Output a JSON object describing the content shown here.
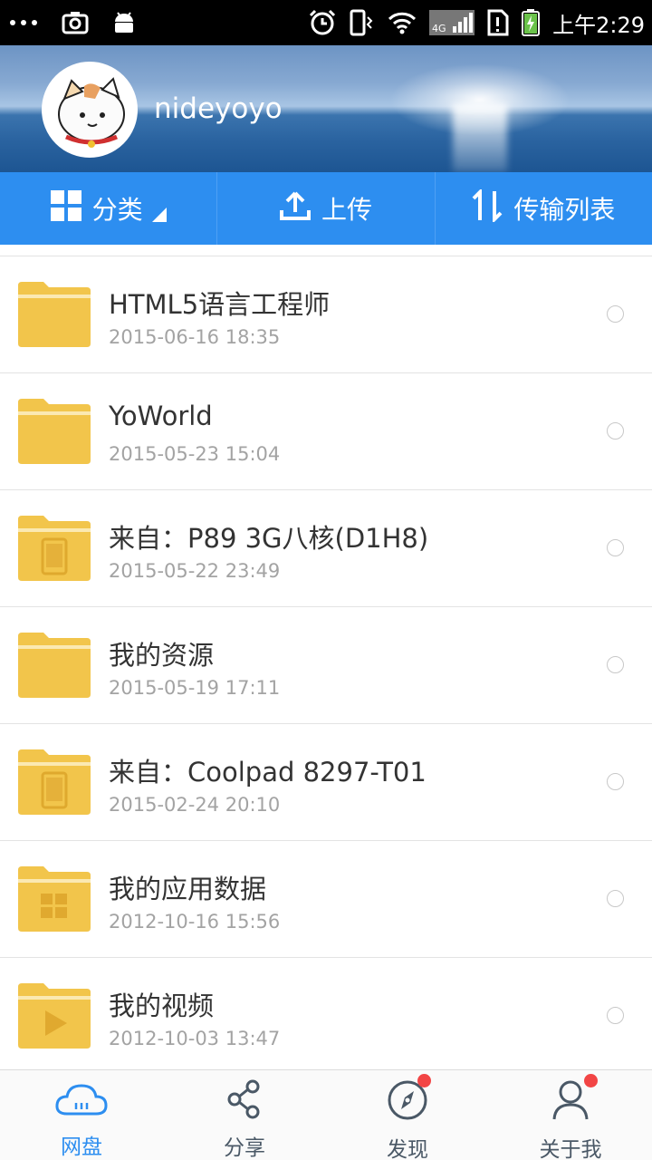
{
  "status_bar": {
    "time": "上午2:29"
  },
  "profile": {
    "username": "nideyoyo"
  },
  "toolbar": {
    "category_label": "分类",
    "upload_label": "上传",
    "transfer_label": "传输列表"
  },
  "files": [
    {
      "name": "HTML5语言工程师",
      "date": "2015-06-16  18:35",
      "folder_type": "plain"
    },
    {
      "name": "YoWorld",
      "date": "2015-05-23  15:04",
      "folder_type": "plain"
    },
    {
      "name": "来自：P89 3G八核(D1H8)",
      "date": "2015-05-22  23:49",
      "folder_type": "device"
    },
    {
      "name": "我的资源",
      "date": "2015-05-19  17:11",
      "folder_type": "plain"
    },
    {
      "name": "来自：Coolpad 8297-T01",
      "date": "2015-02-24  20:10",
      "folder_type": "device"
    },
    {
      "name": "我的应用数据",
      "date": "2012-10-16  15:56",
      "folder_type": "apps"
    },
    {
      "name": "我的视频",
      "date": "2012-10-03  13:47",
      "folder_type": "video"
    }
  ],
  "bottom_nav": {
    "items": [
      {
        "label": "网盘",
        "icon": "cloud-icon",
        "active": true
      },
      {
        "label": "分享",
        "icon": "share-icon",
        "active": false
      },
      {
        "label": "发现",
        "icon": "compass-icon",
        "active": false,
        "badge": true
      },
      {
        "label": "关于我",
        "icon": "person-icon",
        "active": false,
        "badge": true
      }
    ]
  },
  "colors": {
    "accent": "#2d8ef0",
    "folder": "#f2c54b",
    "badge": "#f24545"
  }
}
